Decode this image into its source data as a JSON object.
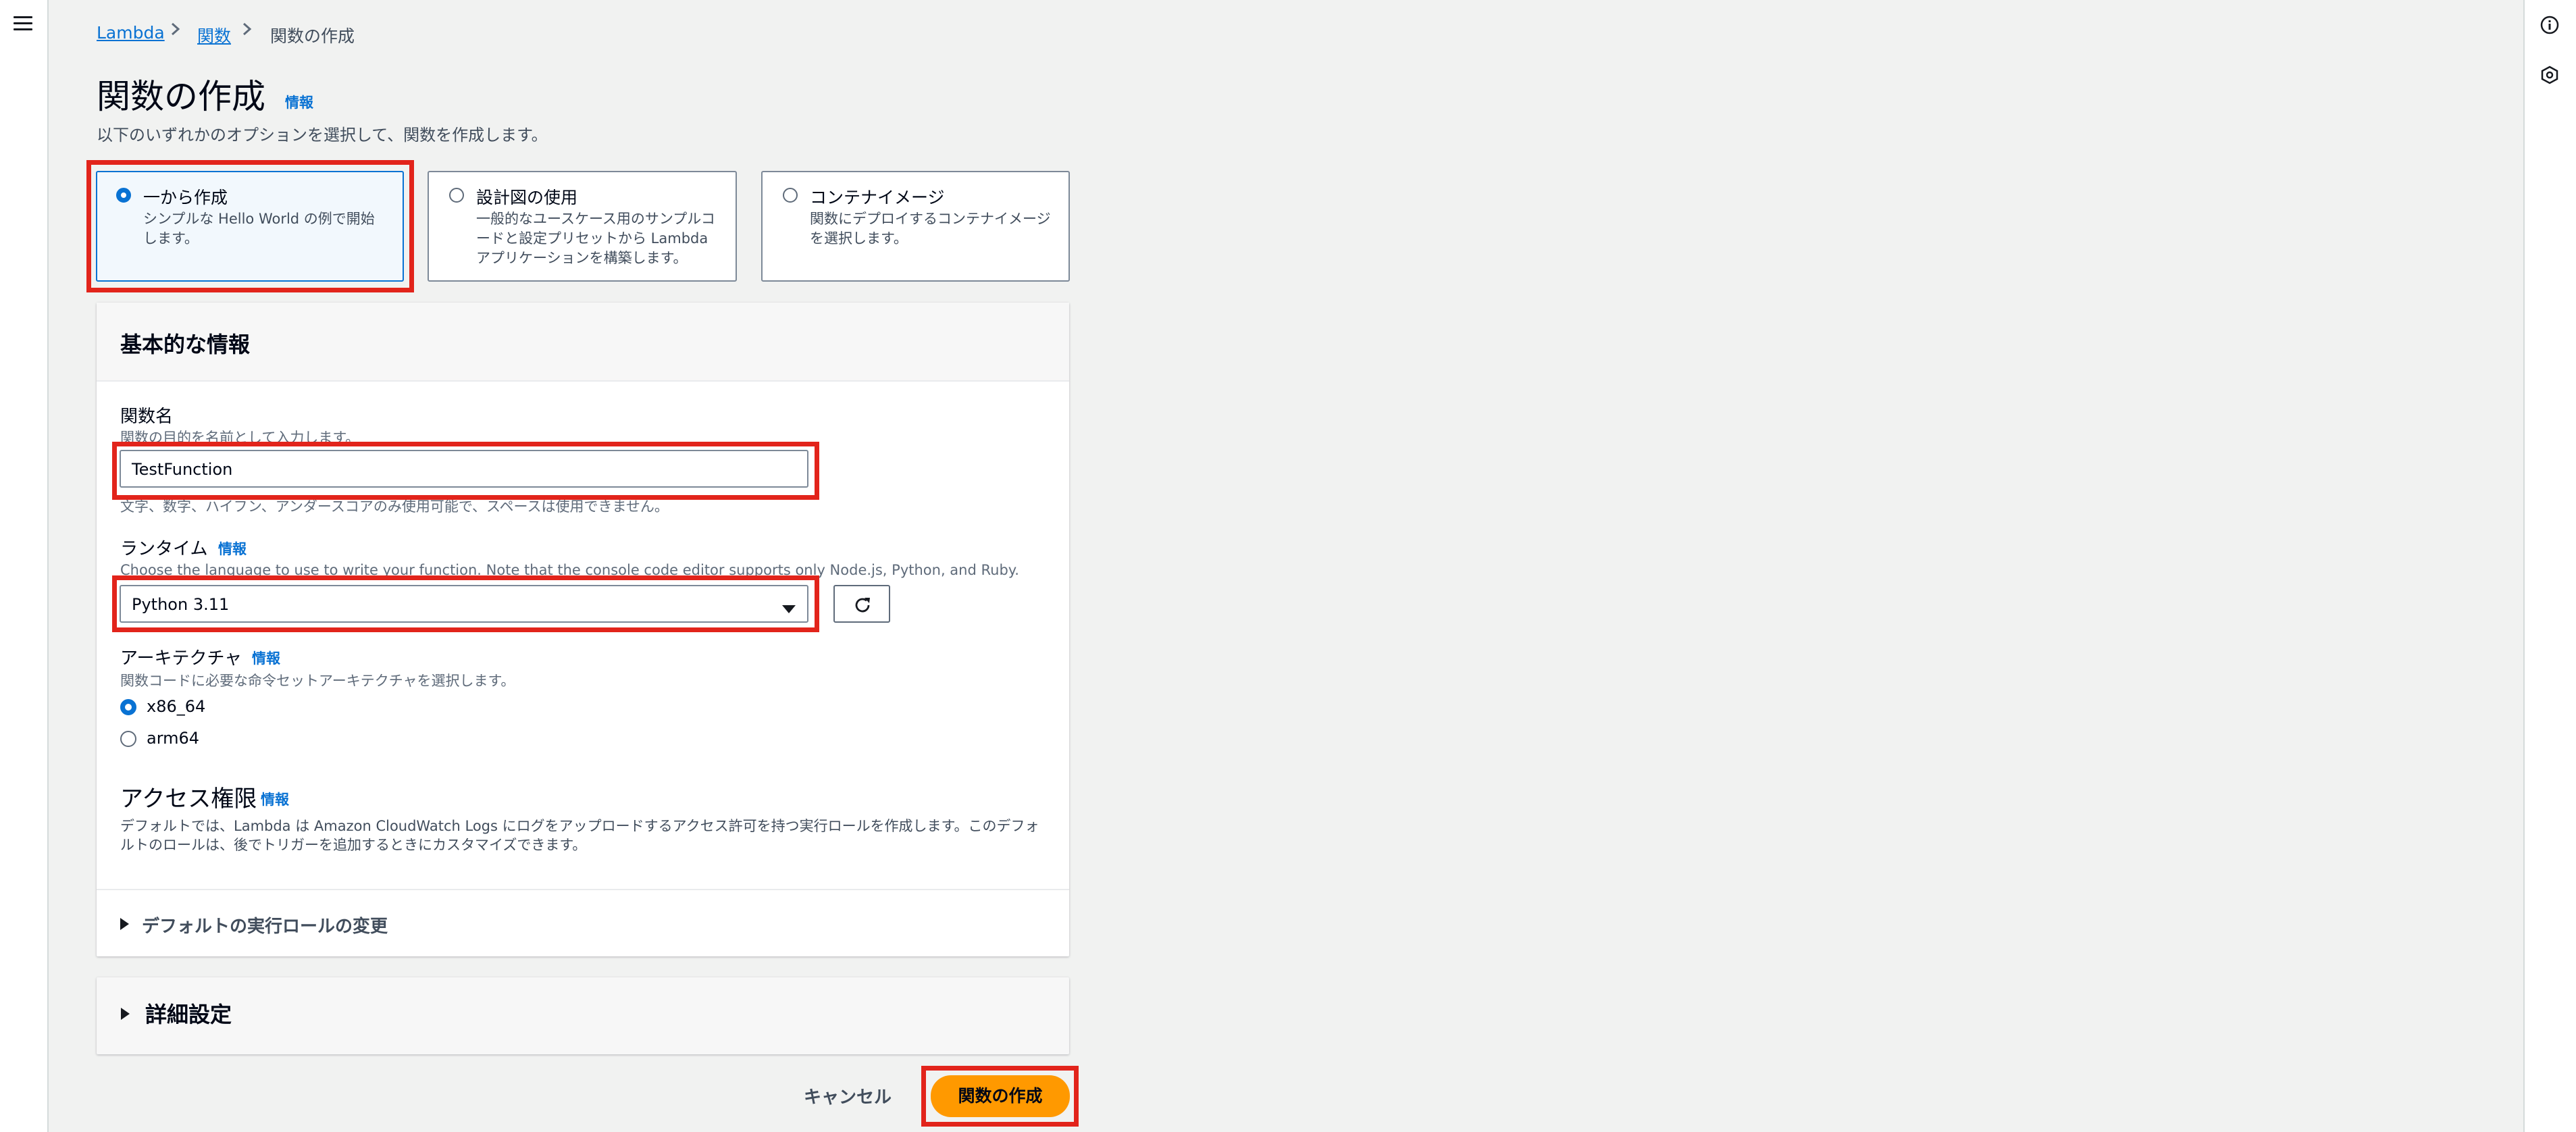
{
  "breadcrumb": {
    "items": [
      "Lambda",
      "関数",
      "関数の作成"
    ]
  },
  "page": {
    "title": "関数の作成",
    "info": "情報",
    "description": "以下のいずれかのオプションを選択して、関数を作成します。"
  },
  "options": [
    {
      "title": "一から作成",
      "desc": "シンプルな Hello World の例で開始します。",
      "selected": true
    },
    {
      "title": "設計図の使用",
      "desc": "一般的なユースケース用のサンプルコードと設定プリセットから Lambda アプリケーションを構築します。",
      "selected": false
    },
    {
      "title": "コンテナイメージ",
      "desc": "関数にデプロイするコンテナイメージを選択します。",
      "selected": false
    }
  ],
  "basic": {
    "header": "基本的な情報",
    "function_name": {
      "label": "関数名",
      "desc": "関数の目的を名前として入力します。",
      "value": "TestFunction",
      "constraint": "文字、数字、ハイフン、アンダースコアのみ使用可能で、スペースは使用できません。"
    },
    "runtime": {
      "label": "ランタイム",
      "info": "情報",
      "desc": "Choose the language to use to write your function. Note that the console code editor supports only Node.js, Python, and Ruby.",
      "value": "Python 3.11"
    },
    "architecture": {
      "label": "アーキテクチャ",
      "info": "情報",
      "desc": "関数コードに必要な命令セットアーキテクチャを選択します。",
      "options": [
        {
          "label": "x86_64",
          "selected": true
        },
        {
          "label": "arm64",
          "selected": false
        }
      ]
    },
    "permissions": {
      "title": "アクセス権限",
      "info": "情報",
      "desc_line1": "デフォルトでは、Lambda は Amazon CloudWatch Logs にログをアップロードするアクセス許可を持つ実行ロールを作成します。このデフォ",
      "desc_line2": "ルトのロールは、後でトリガーを追加するときにカスタマイズできます。"
    },
    "change_role": "デフォルトの実行ロールの変更"
  },
  "advanced": {
    "title": "詳細設定"
  },
  "actions": {
    "cancel": "キャンセル",
    "create": "関数の作成"
  },
  "colors": {
    "accent": "#0972d3",
    "primary_button": "#ff9900",
    "highlight": "#e2241b"
  }
}
